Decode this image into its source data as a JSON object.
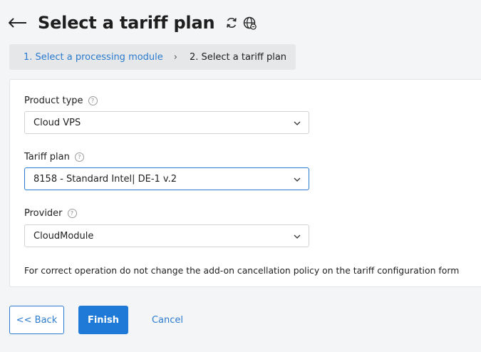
{
  "header": {
    "title": "Select a tariff plan"
  },
  "breadcrumb": {
    "step1": "1. Select a processing module",
    "separator": "›",
    "step2": "2. Select a tariff plan"
  },
  "form": {
    "product_type": {
      "label": "Product type",
      "value": "Cloud VPS"
    },
    "tariff_plan": {
      "label": "Tariff plan",
      "value": "8158 - Standard Intel| DE-1 v.2"
    },
    "provider": {
      "label": "Provider",
      "value": "CloudModule"
    },
    "help_glyph": "?",
    "note": "For correct operation do not change the add-on cancellation policy on the tariff configuration form"
  },
  "buttons": {
    "back": "<< Back",
    "finish": "Finish",
    "cancel": "Cancel"
  },
  "colors": {
    "accent": "#2b7bd0",
    "primary_button": "#1e7ad6",
    "background": "#f4f5f6"
  },
  "icons": [
    "arrow-left-icon",
    "refresh-icon",
    "globe-icon",
    "help-icon",
    "chevron-down-icon"
  ]
}
